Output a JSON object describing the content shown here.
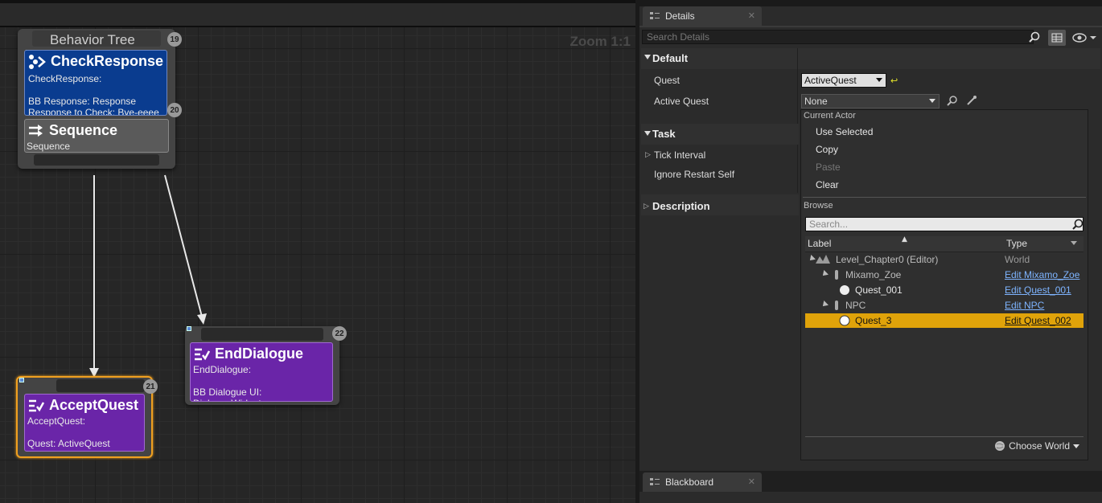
{
  "graph": {
    "zoom_label": "Zoom 1:1",
    "composite_node": {
      "header_title": "Behavior Tree",
      "header_index": "19",
      "decorator": {
        "title": "CheckResponse",
        "line1": "CheckResponse:",
        "line2": "BB Response: Response",
        "line3": "Response to Check: Bye-eeee",
        "index": "20"
      },
      "sequence": {
        "title": "Sequence",
        "subtitle": "Sequence"
      }
    },
    "end_dialogue_node": {
      "index": "22",
      "title": "EndDialogue",
      "line1": "EndDialogue:",
      "line2": "BB Dialogue UI: DialogueWidget"
    },
    "accept_quest_node": {
      "index": "21",
      "title": "AcceptQuest",
      "line1": "AcceptQuest:",
      "line2": "Quest: ActiveQuest"
    }
  },
  "details": {
    "tab_label": "Details",
    "search_placeholder": "Search Details",
    "category_default": "Default",
    "quest_label": "Quest",
    "quest_value": "ActiveQuest",
    "active_quest_label": "Active Quest",
    "active_quest_value": "None",
    "category_task": "Task",
    "tick_interval_label": "Tick Interval",
    "ignore_restart_label": "Ignore Restart Self",
    "category_description": "Description"
  },
  "popup": {
    "current_actor_header": "Current Actor",
    "menu_items": [
      "Use Selected",
      "Copy",
      "Paste",
      "Clear"
    ],
    "browse_header": "Browse",
    "search_placeholder": "Search...",
    "col_label": "Label",
    "col_type": "Type",
    "tree": [
      {
        "name": "Level_Chapter0 (Editor)",
        "type": "World"
      },
      {
        "name": "Mixamo_Zoe",
        "type": "Edit Mixamo_Zoe"
      },
      {
        "name": "Quest_001",
        "type": "Edit Quest_001"
      },
      {
        "name": "NPC",
        "type": "Edit NPC"
      },
      {
        "name": "Quest_3",
        "type": "Edit Quest_002"
      }
    ],
    "choose_world": "Choose World"
  },
  "blackboard": {
    "tab_label": "Blackboard"
  },
  "colors": {
    "decorator_blue": "#0a3c8f",
    "task_purple": "#6a25a8",
    "selected_orange": "#e0a30a",
    "link_blue": "#7eb4ff"
  }
}
